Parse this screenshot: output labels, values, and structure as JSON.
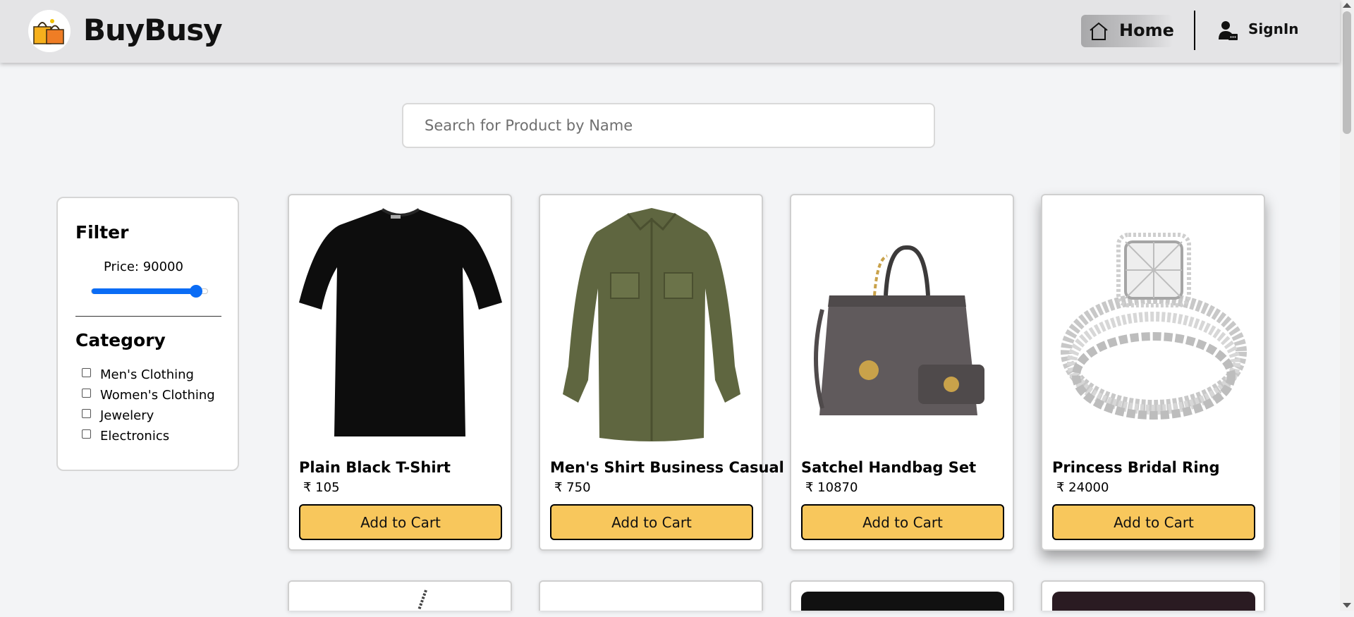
{
  "navbar": {
    "brand": "BuyBusy",
    "home_label": "Home",
    "signin_label": "SignIn"
  },
  "search": {
    "placeholder": "Search for Product by Name",
    "value": ""
  },
  "filter": {
    "title": "Filter",
    "price_label": "Price: 90000",
    "price_value": 90000,
    "price_slider_fraction": 0.9,
    "category_title": "Category",
    "categories": [
      {
        "label": "Men's Clothing",
        "checked": false
      },
      {
        "label": "Women's Clothing",
        "checked": false
      },
      {
        "label": "Jewelery",
        "checked": false
      },
      {
        "label": "Electronics",
        "checked": false
      }
    ]
  },
  "products": [
    {
      "name": "Plain Black T-Shirt",
      "price": "₹ 105",
      "button": "Add to Cart",
      "image_icon": "tshirt-image"
    },
    {
      "name": "Men's Shirt Business Casual",
      "price": "₹ 750",
      "button": "Add to Cart",
      "image_icon": "shirt-image"
    },
    {
      "name": "Satchel Handbag Set",
      "price": "₹ 10870",
      "button": "Add to Cart",
      "image_icon": "handbag-image"
    },
    {
      "name": "Princess Bridal Ring",
      "price": "₹ 24000",
      "button": "Add to Cart",
      "image_icon": "ring-image"
    }
  ],
  "colors": {
    "accent": "#0a6cf5",
    "button": "#f8c75c",
    "navbar": "#e4e4e6",
    "background": "#f3f4f6"
  }
}
